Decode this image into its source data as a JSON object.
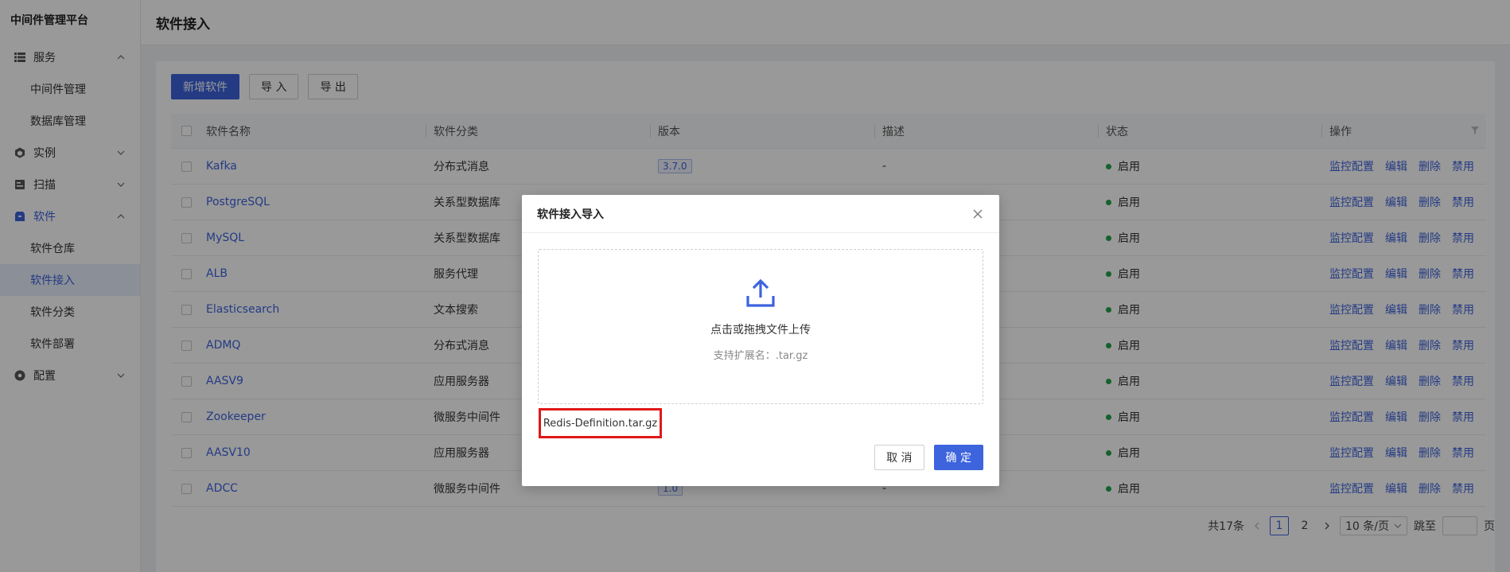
{
  "app": {
    "brand": "中间件管理平台"
  },
  "sidebar": {
    "groups": [
      {
        "label": "服务",
        "icon": "list-icon",
        "expanded": true,
        "items": [
          {
            "label": "中间件管理"
          },
          {
            "label": "数据库管理"
          }
        ]
      },
      {
        "label": "实例",
        "icon": "cube-icon",
        "expanded": false,
        "items": []
      },
      {
        "label": "扫描",
        "icon": "scan-icon",
        "expanded": false,
        "items": []
      },
      {
        "label": "软件",
        "icon": "package-icon",
        "expanded": true,
        "items": [
          {
            "label": "软件仓库"
          },
          {
            "label": "软件接入"
          },
          {
            "label": "软件分类"
          },
          {
            "label": "软件部署"
          }
        ]
      },
      {
        "label": "配置",
        "icon": "settings-icon",
        "expanded": false,
        "items": []
      }
    ]
  },
  "page": {
    "title": "软件接入"
  },
  "toolbar": {
    "add": "新增软件",
    "import": "导 入",
    "export": "导 出"
  },
  "table": {
    "columns": [
      "软件名称",
      "软件分类",
      "版本",
      "描述",
      "状态",
      "操作"
    ],
    "rows": [
      {
        "name": "Kafka",
        "category": "分布式消息",
        "version": "3.7.0",
        "desc": "-",
        "status": "启用"
      },
      {
        "name": "PostgreSQL",
        "category": "关系型数据库",
        "version": "",
        "desc": "",
        "status": "启用"
      },
      {
        "name": "MySQL",
        "category": "关系型数据库",
        "version": "",
        "desc": "",
        "status": "启用"
      },
      {
        "name": "ALB",
        "category": "服务代理",
        "version": "",
        "desc": "",
        "status": "启用"
      },
      {
        "name": "Elasticsearch",
        "category": "文本搜索",
        "version": "",
        "desc": "",
        "status": "启用"
      },
      {
        "name": "ADMQ",
        "category": "分布式消息",
        "version": "",
        "desc": "",
        "status": "启用"
      },
      {
        "name": "AASV9",
        "category": "应用服务器",
        "version": "",
        "desc": "",
        "status": "启用"
      },
      {
        "name": "Zookeeper",
        "category": "微服务中间件",
        "version": "",
        "desc": "",
        "status": "启用"
      },
      {
        "name": "AASV10",
        "category": "应用服务器",
        "version": "",
        "desc": "",
        "status": "启用"
      },
      {
        "name": "ADCC",
        "category": "微服务中间件",
        "version": "1.0",
        "desc": "-",
        "status": "启用"
      }
    ],
    "actions": [
      "监控配置",
      "编辑",
      "删除",
      "禁用"
    ]
  },
  "pagination": {
    "total": "共17条",
    "pages": [
      "1",
      "2"
    ],
    "current": "1",
    "page_size": "10 条/页",
    "jump_label": "跳至",
    "page_suffix": "页"
  },
  "modal": {
    "title": "软件接入导入",
    "upload_text": "点击或拖拽文件上传",
    "upload_hint": "支持扩展名：.tar.gz",
    "file_name": "Redis-Definition.tar.gz",
    "cancel": "取 消",
    "confirm": "确 定"
  },
  "colors": {
    "primary": "#3d63dd",
    "status_on": "#22a34a",
    "highlight": "#e01818"
  }
}
